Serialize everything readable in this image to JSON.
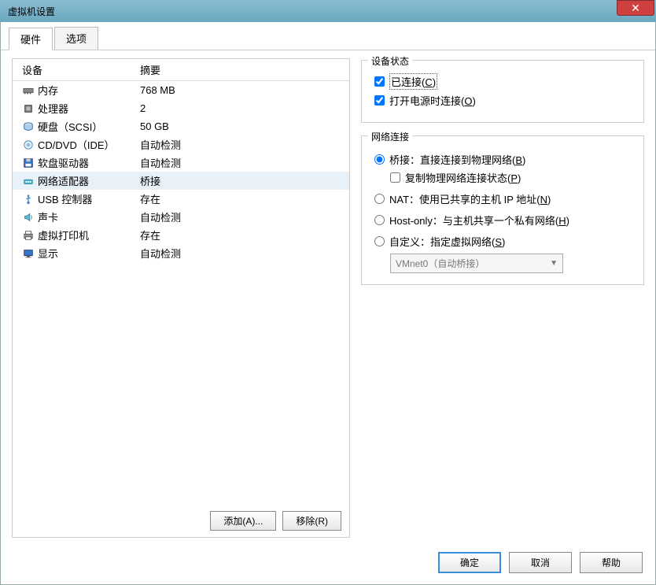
{
  "title": "虚拟机设置",
  "close_glyph": "✕",
  "tabs": {
    "hardware": "硬件",
    "options": "选项"
  },
  "hw_header": {
    "device": "设备",
    "summary": "摘要"
  },
  "devices": [
    {
      "name": "内存",
      "summary": "768 MB",
      "icon": "memory"
    },
    {
      "name": "处理器",
      "summary": "2",
      "icon": "cpu"
    },
    {
      "name": "硬盘（SCSI）",
      "summary": "50 GB",
      "icon": "disk"
    },
    {
      "name": "CD/DVD（IDE）",
      "summary": "自动检测",
      "icon": "cd"
    },
    {
      "name": "软盘驱动器",
      "summary": "自动检测",
      "icon": "floppy"
    },
    {
      "name": "网络适配器",
      "summary": "桥接",
      "icon": "net",
      "selected": true
    },
    {
      "name": "USB 控制器",
      "summary": "存在",
      "icon": "usb"
    },
    {
      "name": "声卡",
      "summary": "自动检测",
      "icon": "sound"
    },
    {
      "name": "虚拟打印机",
      "summary": "存在",
      "icon": "printer"
    },
    {
      "name": "显示",
      "summary": "自动检测",
      "icon": "display"
    }
  ],
  "hw_buttons": {
    "add": "添加(A)...",
    "remove": "移除(R)"
  },
  "status_group": {
    "title": "设备状态",
    "connected": "已连接(C)",
    "connect_at_poweron": "打开电源时连接(O)"
  },
  "network_group": {
    "title": "网络连接",
    "bridged": "桥接：直接连接到物理网络(B)",
    "replicate": "复制物理网络连接状态(P)",
    "nat": "NAT：使用已共享的主机 IP 地址(N)",
    "hostonly": "Host-only：与主机共享一个私有网络(H)",
    "custom": "自定义：指定虚拟网络(S)",
    "custom_value": "VMnet0（自动桥接）"
  },
  "footer": {
    "ok": "确定",
    "cancel": "取消",
    "help": "帮助"
  }
}
